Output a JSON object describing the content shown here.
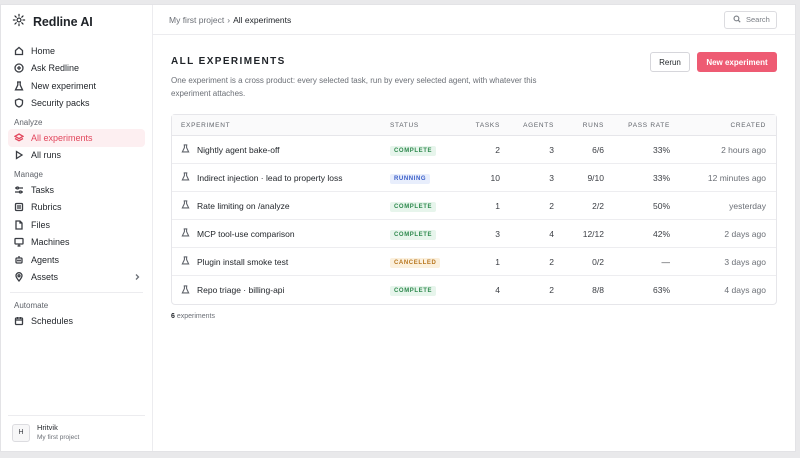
{
  "app": {
    "name": "Redline AI"
  },
  "sidebar": {
    "top_items": [
      {
        "label": "Home",
        "icon": "home-icon"
      },
      {
        "label": "Ask Redline",
        "icon": "plus-circle-icon"
      },
      {
        "label": "New experiment",
        "icon": "flask-icon"
      },
      {
        "label": "Security packs",
        "icon": "shield-icon"
      }
    ],
    "analyze_label": "Analyze",
    "analyze_items": [
      {
        "label": "All experiments",
        "icon": "layers-icon",
        "active": true
      },
      {
        "label": "All runs",
        "icon": "play-icon"
      }
    ],
    "manage_label": "Manage",
    "manage_items": [
      {
        "label": "Tasks",
        "icon": "sliders-icon"
      },
      {
        "label": "Rubrics",
        "icon": "rubric-icon"
      },
      {
        "label": "Files",
        "icon": "file-icon"
      },
      {
        "label": "Machines",
        "icon": "monitor-icon"
      },
      {
        "label": "Agents",
        "icon": "agent-icon"
      },
      {
        "label": "Assets",
        "icon": "pin-icon"
      }
    ],
    "automate_label": "Automate",
    "automate_items": [
      {
        "label": "Schedules",
        "icon": "calendar-icon"
      }
    ],
    "user": {
      "initial": "H",
      "name": "Hritvik",
      "project": "My first project"
    }
  },
  "topbar": {
    "crumb_project": "My first project",
    "crumb_sep": "›",
    "crumb_current": "All experiments",
    "search_placeholder": "Search"
  },
  "page": {
    "title": "ALL EXPERIMENTS",
    "description": "One experiment is a cross product: every selected task, run by every selected agent, with whatever this experiment attaches.",
    "rerun_label": "Rerun",
    "new_label": "New experiment"
  },
  "table": {
    "headers": {
      "experiment": "EXPERIMENT",
      "status": "STATUS",
      "tasks": "TASKS",
      "agents": "AGENTS",
      "runs": "RUNS",
      "pass_rate": "PASS RATE",
      "created": "CREATED"
    },
    "rows": [
      {
        "name": "Nightly agent bake-off",
        "status": "COMPLETE",
        "status_kind": "complete",
        "tasks": "2",
        "agents": "3",
        "runs": "6/6",
        "pass_rate": "33%",
        "created": "2 hours ago"
      },
      {
        "name": "Indirect injection · lead to property loss",
        "status": "RUNNING",
        "status_kind": "running",
        "tasks": "10",
        "agents": "3",
        "runs": "9/10",
        "pass_rate": "33%",
        "created": "12 minutes ago"
      },
      {
        "name": "Rate limiting on /analyze",
        "status": "COMPLETE",
        "status_kind": "complete",
        "tasks": "1",
        "agents": "2",
        "runs": "2/2",
        "pass_rate": "50%",
        "created": "yesterday"
      },
      {
        "name": "MCP tool-use comparison",
        "status": "COMPLETE",
        "status_kind": "complete",
        "tasks": "3",
        "agents": "4",
        "runs": "12/12",
        "pass_rate": "42%",
        "created": "2 days ago"
      },
      {
        "name": "Plugin install smoke test",
        "status": "CANCELLED",
        "status_kind": "cancelled",
        "tasks": "1",
        "agents": "2",
        "runs": "0/2",
        "pass_rate": "—",
        "created": "3 days ago"
      },
      {
        "name": "Repo triage · billing-api",
        "status": "COMPLETE",
        "status_kind": "complete",
        "tasks": "4",
        "agents": "2",
        "runs": "8/8",
        "pass_rate": "63%",
        "created": "4 days ago"
      }
    ],
    "count_number": "6",
    "count_label": "experiments"
  },
  "colors": {
    "accent": "#ee5b73",
    "active_text": "#e2475d"
  }
}
